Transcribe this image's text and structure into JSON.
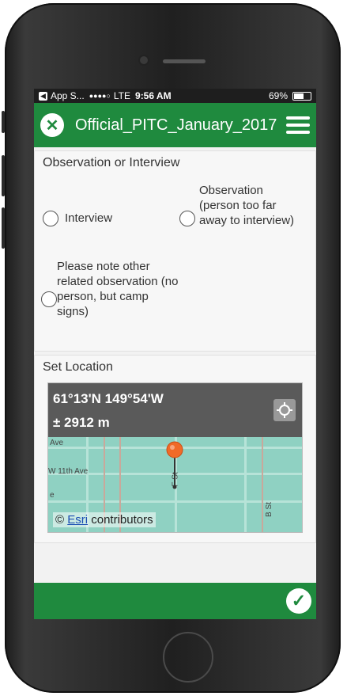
{
  "status_bar": {
    "app": "App S...",
    "signal": "●●●●○",
    "network": "LTE",
    "time": "9:56 AM",
    "battery_percent": "69%",
    "battery_level": 0.69
  },
  "header": {
    "title": "Official_PITC_January_2017",
    "close_icon": "close-icon",
    "menu_icon": "hamburger-menu-icon"
  },
  "observation": {
    "question": "Observation or Interview",
    "options": [
      {
        "label": "Interview"
      },
      {
        "label": "Observation (person too far away to interview)"
      },
      {
        "label": "Please note other related observation (no person, but camp signs)"
      }
    ]
  },
  "location": {
    "label": "Set Location",
    "coordinates": "61°13'N 149°54'W",
    "accuracy": "± 2912 m",
    "attribution_prefix": "©",
    "attribution_link": "Esri",
    "attribution_suffix": "contributors",
    "street_labels": [
      "Ave",
      "W 11th Ave",
      "e",
      "F St",
      "B St"
    ]
  },
  "footer": {
    "submit_icon": "checkmark-icon"
  },
  "colors": {
    "brand_green": "#1f8a3e",
    "map_water": "#8fd1c2",
    "pin": "#f06a28"
  }
}
